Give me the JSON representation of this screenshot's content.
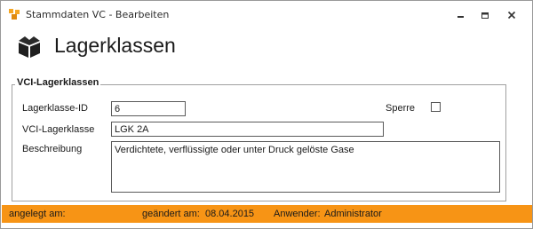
{
  "window": {
    "title": "Stammdaten VC - Bearbeiten",
    "app_icon": "cubes-icon",
    "buttons": [
      "minimize-icon",
      "restore-icon",
      "close-icon"
    ]
  },
  "header": {
    "icon": "box-icon",
    "title": "Lagerklassen"
  },
  "group": {
    "legend": "VCI-Lagerklassen"
  },
  "form": {
    "id_label": "Lagerklasse-ID",
    "id_value": "6",
    "sperre_label": "Sperre",
    "sperre_checked": false,
    "vci_label": "VCI-Lagerklasse",
    "vci_value": "LGK 2A",
    "desc_label": "Beschreibung",
    "desc_value": "Verdichtete, verflüssigte oder unter Druck gelöste Gase"
  },
  "status": {
    "created_label": "angelegt am:",
    "changed_label": "geändert am:",
    "changed_value": "08.04.2015",
    "user_label": "Anwender:",
    "user_value": "Administrator"
  },
  "colors": {
    "status_bar": "#f79415",
    "app_icon": "#f5a623"
  }
}
